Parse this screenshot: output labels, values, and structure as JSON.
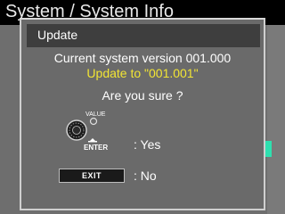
{
  "screen": {
    "title": "System / System Info"
  },
  "dialog": {
    "header": "Update",
    "current_version": "Current system version 001.000",
    "update_to": "Update to \"001.001\"",
    "confirm": "Are you sure ?",
    "knob_label": "VALUE",
    "enter_label": "ENTER",
    "yes_label": ": Yes",
    "exit_label": "EXIT",
    "no_label": ": No"
  },
  "colors": {
    "highlight_yellow": "#f2e534",
    "scroll_marker": "#2ee0b0",
    "header_bg": "#3e3e3e",
    "dialog_bg": "#6a6a6a"
  },
  "icons": {
    "knob": "value-knob-icon",
    "enter": "enter-arrow-icon"
  }
}
